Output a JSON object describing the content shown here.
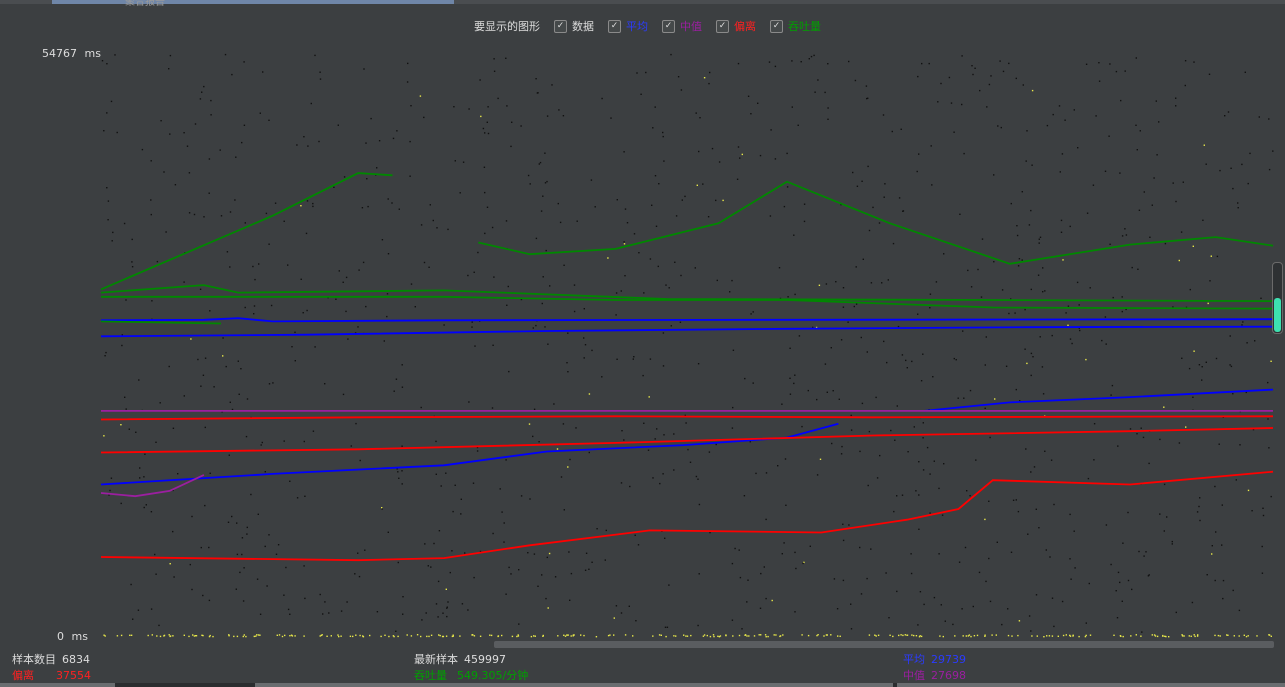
{
  "window": {
    "tab_title": "聚合报告"
  },
  "legend": {
    "title": "要显示的图形",
    "items": [
      {
        "label": "数据",
        "checked": true,
        "color": "#dddddd"
      },
      {
        "label": "平均",
        "checked": true,
        "color": "#0000ff"
      },
      {
        "label": "中值",
        "checked": true,
        "color": "#9b1fa0"
      },
      {
        "label": "偏离",
        "checked": true,
        "color": "#ff0000"
      },
      {
        "label": "吞吐量",
        "checked": true,
        "color": "#008800"
      }
    ]
  },
  "chart_data": {
    "type": "scatter",
    "y_unit": "ms",
    "ylim": [
      0,
      54767
    ],
    "y_max_label": "54767",
    "y_min_label": "0",
    "x_axis": "sample_index",
    "xlim": [
      0,
      6834
    ],
    "grid": false,
    "series": [
      {
        "name": "平均",
        "color": "#0000ff",
        "points": [
          [
            0,
            28200
          ],
          [
            1200,
            28350
          ],
          [
            2600,
            28700
          ],
          [
            4000,
            28900
          ],
          [
            5400,
            29050
          ],
          [
            6834,
            29100
          ]
        ]
      },
      {
        "name": "平均",
        "color": "#0000ff",
        "points": [
          [
            0,
            29700
          ],
          [
            600,
            29750
          ],
          [
            800,
            29900
          ],
          [
            1000,
            29600
          ],
          [
            2000,
            29700
          ],
          [
            4000,
            29750
          ],
          [
            6834,
            29800
          ]
        ]
      },
      {
        "name": "平均",
        "color": "#0000ff",
        "points": [
          [
            0,
            14300
          ],
          [
            1000,
            15300
          ],
          [
            2000,
            16100
          ],
          [
            2600,
            17400
          ],
          [
            3400,
            18000
          ],
          [
            4000,
            18700
          ],
          [
            4300,
            20000
          ]
        ]
      },
      {
        "name": "平均",
        "color": "#0000ff",
        "points": [
          [
            4800,
            21200
          ],
          [
            5300,
            22000
          ],
          [
            6000,
            22500
          ],
          [
            6834,
            23200
          ]
        ]
      },
      {
        "name": "中值",
        "color": "#9b1fa0",
        "points": [
          [
            0,
            21200
          ],
          [
            6834,
            21200
          ]
        ]
      },
      {
        "name": "中值",
        "color": "#9b1fa0",
        "points": [
          [
            0,
            13500
          ],
          [
            200,
            13200
          ],
          [
            400,
            13700
          ],
          [
            600,
            15200
          ]
        ]
      },
      {
        "name": "偏离",
        "color": "#ff0000",
        "points": [
          [
            0,
            20400
          ],
          [
            1500,
            20600
          ],
          [
            3000,
            20700
          ],
          [
            4500,
            20600
          ],
          [
            6834,
            20700
          ]
        ]
      },
      {
        "name": "偏离",
        "color": "#ff0000",
        "points": [
          [
            0,
            17300
          ],
          [
            1500,
            17600
          ],
          [
            3000,
            18200
          ],
          [
            4500,
            18900
          ],
          [
            6000,
            19300
          ],
          [
            6834,
            19600
          ]
        ]
      },
      {
        "name": "偏离",
        "color": "#ff0000",
        "points": [
          [
            0,
            7500
          ],
          [
            1500,
            7200
          ],
          [
            2000,
            7400
          ],
          [
            2500,
            8600
          ],
          [
            3200,
            10000
          ],
          [
            4200,
            9800
          ],
          [
            4700,
            11000
          ],
          [
            5000,
            12000
          ],
          [
            5200,
            14700
          ],
          [
            6000,
            14300
          ],
          [
            6834,
            15500
          ]
        ]
      },
      {
        "name": "吞吐量",
        "color": "#008800",
        "points": [
          [
            0,
            32600
          ],
          [
            1000,
            39500
          ],
          [
            1500,
            43500
          ],
          [
            1700,
            43300
          ]
        ]
      },
      {
        "name": "吞吐量",
        "color": "#008800",
        "points": [
          [
            2200,
            37000
          ],
          [
            2500,
            35900
          ],
          [
            3000,
            36400
          ],
          [
            3600,
            38800
          ],
          [
            4000,
            42700
          ],
          [
            4600,
            38800
          ],
          [
            5300,
            35000
          ],
          [
            6000,
            36800
          ],
          [
            6500,
            37500
          ],
          [
            6834,
            36700
          ]
        ]
      },
      {
        "name": "吞吐量",
        "color": "#008800",
        "points": [
          [
            0,
            32300
          ],
          [
            600,
            33000
          ],
          [
            800,
            32300
          ],
          [
            2000,
            32500
          ],
          [
            3300,
            31700
          ],
          [
            5200,
            31600
          ],
          [
            6834,
            31500
          ]
        ]
      },
      {
        "name": "吞吐量",
        "color": "#008800",
        "points": [
          [
            0,
            31900
          ],
          [
            1000,
            31900
          ],
          [
            2000,
            31900
          ],
          [
            3000,
            31600
          ],
          [
            4000,
            31600
          ],
          [
            5200,
            30900
          ],
          [
            6834,
            30800
          ]
        ]
      },
      {
        "name": "吞吐量",
        "color": "#008800",
        "points": [
          [
            0,
            29600
          ],
          [
            700,
            29400
          ]
        ]
      }
    ]
  },
  "stats": {
    "sample_count_label": "样本数目",
    "sample_count_value": "6834",
    "deviation_label": "偏离",
    "deviation_value": "37554",
    "latest_sample_label": "最新样本",
    "latest_sample_value": "459997",
    "throughput_label": "吞吐量",
    "throughput_value": "549.305/分钟",
    "average_label": "平均",
    "average_value": "29739",
    "median_label": "中值",
    "median_value": "27698"
  },
  "colors": {
    "background": "#3c3f41",
    "average": "#0000ff",
    "median": "#9b1fa0",
    "deviation": "#ff0000",
    "throughput": "#008800",
    "data_points": "#111111",
    "scroll_fill": "#3de0b0"
  },
  "scroll": {
    "level": 0.5
  }
}
